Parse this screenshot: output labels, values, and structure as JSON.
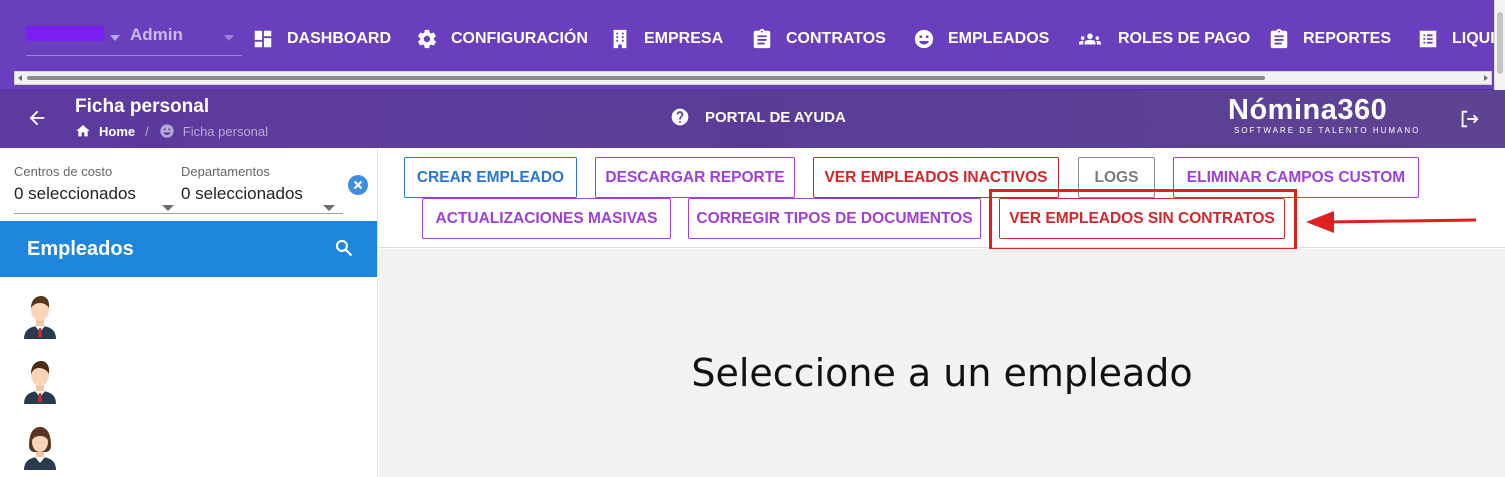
{
  "topnav": {
    "user_role": "Admin",
    "items": [
      {
        "label": "DASHBOARD",
        "icon": "dashboard-icon"
      },
      {
        "label": "CONFIGURACIÓN",
        "icon": "gear-icon"
      },
      {
        "label": "EMPRESA",
        "icon": "building-icon"
      },
      {
        "label": "CONTRATOS",
        "icon": "clipboard-icon"
      },
      {
        "label": "EMPLEADOS",
        "icon": "face-icon"
      },
      {
        "label": "ROLES DE PAGO",
        "icon": "people-icon"
      },
      {
        "label": "REPORTES",
        "icon": "clipboard-list-icon"
      },
      {
        "label": "LIQUI",
        "icon": "list-icon"
      }
    ]
  },
  "header": {
    "title": "Ficha personal",
    "breadcrumb": {
      "home": "Home",
      "separator": "/",
      "current": "Ficha personal"
    },
    "help_label": "PORTAL DE AYUDA",
    "brand_name": "Nómina360",
    "brand_tagline": "SOFTWARE DE TALENTO HUMANO"
  },
  "filters": {
    "cost_centers": {
      "label": "Centros de costo",
      "value": "0 seleccionados"
    },
    "departments": {
      "label": "Departamentos",
      "value": "0 seleccionados"
    }
  },
  "employees_panel": {
    "title": "Empleados",
    "avatars": [
      "male-avatar",
      "male-avatar",
      "female-avatar"
    ]
  },
  "toolbar": {
    "buttons": [
      {
        "label": "CREAR EMPLEADO",
        "color": "#2a75d0"
      },
      {
        "label": "DESCARGAR REPORTE",
        "color": "#9d3fd8"
      },
      {
        "label": "VER EMPLEADOS INACTIVOS",
        "color": "#d3262c"
      },
      {
        "label": "LOGS",
        "color": "#7b7b7b"
      },
      {
        "label": "ELIMINAR CAMPOS CUSTOM",
        "color": "#9d3fd8"
      },
      {
        "label": "ACTUALIZACIONES MASIVAS",
        "color": "#9d3fd8"
      },
      {
        "label": "CORREGIR TIPOS DE DOCUMENTOS",
        "color": "#9d3fd8"
      },
      {
        "label": "VER EMPLEADOS SIN CONTRATOS",
        "color": "#d3262c"
      }
    ]
  },
  "main": {
    "placeholder": "Seleccione a un empleado"
  },
  "colors": {
    "nav_bg": "#6a3fbd",
    "subheader_bg": "#5d3a9e",
    "panel_header_bg": "#1f86de",
    "annotation_red": "#e01f1f"
  }
}
